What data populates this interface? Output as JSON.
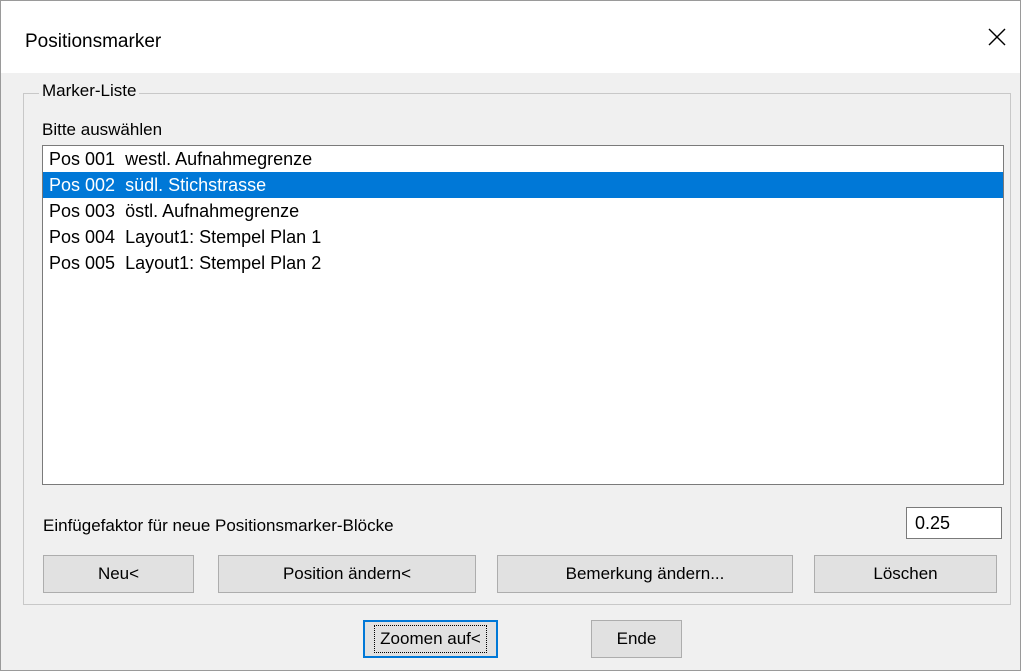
{
  "window": {
    "title": "Positionsmarker"
  },
  "group": {
    "title": "Marker-Liste"
  },
  "list": {
    "label": "Bitte auswählen",
    "items": [
      {
        "pos": "Pos 001",
        "text": "westl. Aufnahmegrenze",
        "selected": false
      },
      {
        "pos": "Pos 002",
        "text": "südl. Stichstrasse",
        "selected": true
      },
      {
        "pos": "Pos 003",
        "text": "östl. Aufnahmegrenze",
        "selected": false
      },
      {
        "pos": "Pos 004",
        "text": "Layout1: Stempel Plan 1",
        "selected": false
      },
      {
        "pos": "Pos 005",
        "text": "Layout1: Stempel Plan 2",
        "selected": false
      }
    ]
  },
  "factor": {
    "label": "Einfügefaktor für neue Positionsmarker-Blöcke",
    "value": "0.25"
  },
  "buttons": {
    "new": "Neu<",
    "change_position": "Position ändern<",
    "change_remark": "Bemerkung ändern...",
    "delete": "Löschen",
    "zoom": "Zoomen auf<",
    "end": "Ende"
  },
  "colors": {
    "selection": "#0078d7",
    "dialog_bg": "#f0f0f0",
    "button_bg": "#e1e1e1"
  },
  "icons": {
    "close": "close-icon"
  }
}
